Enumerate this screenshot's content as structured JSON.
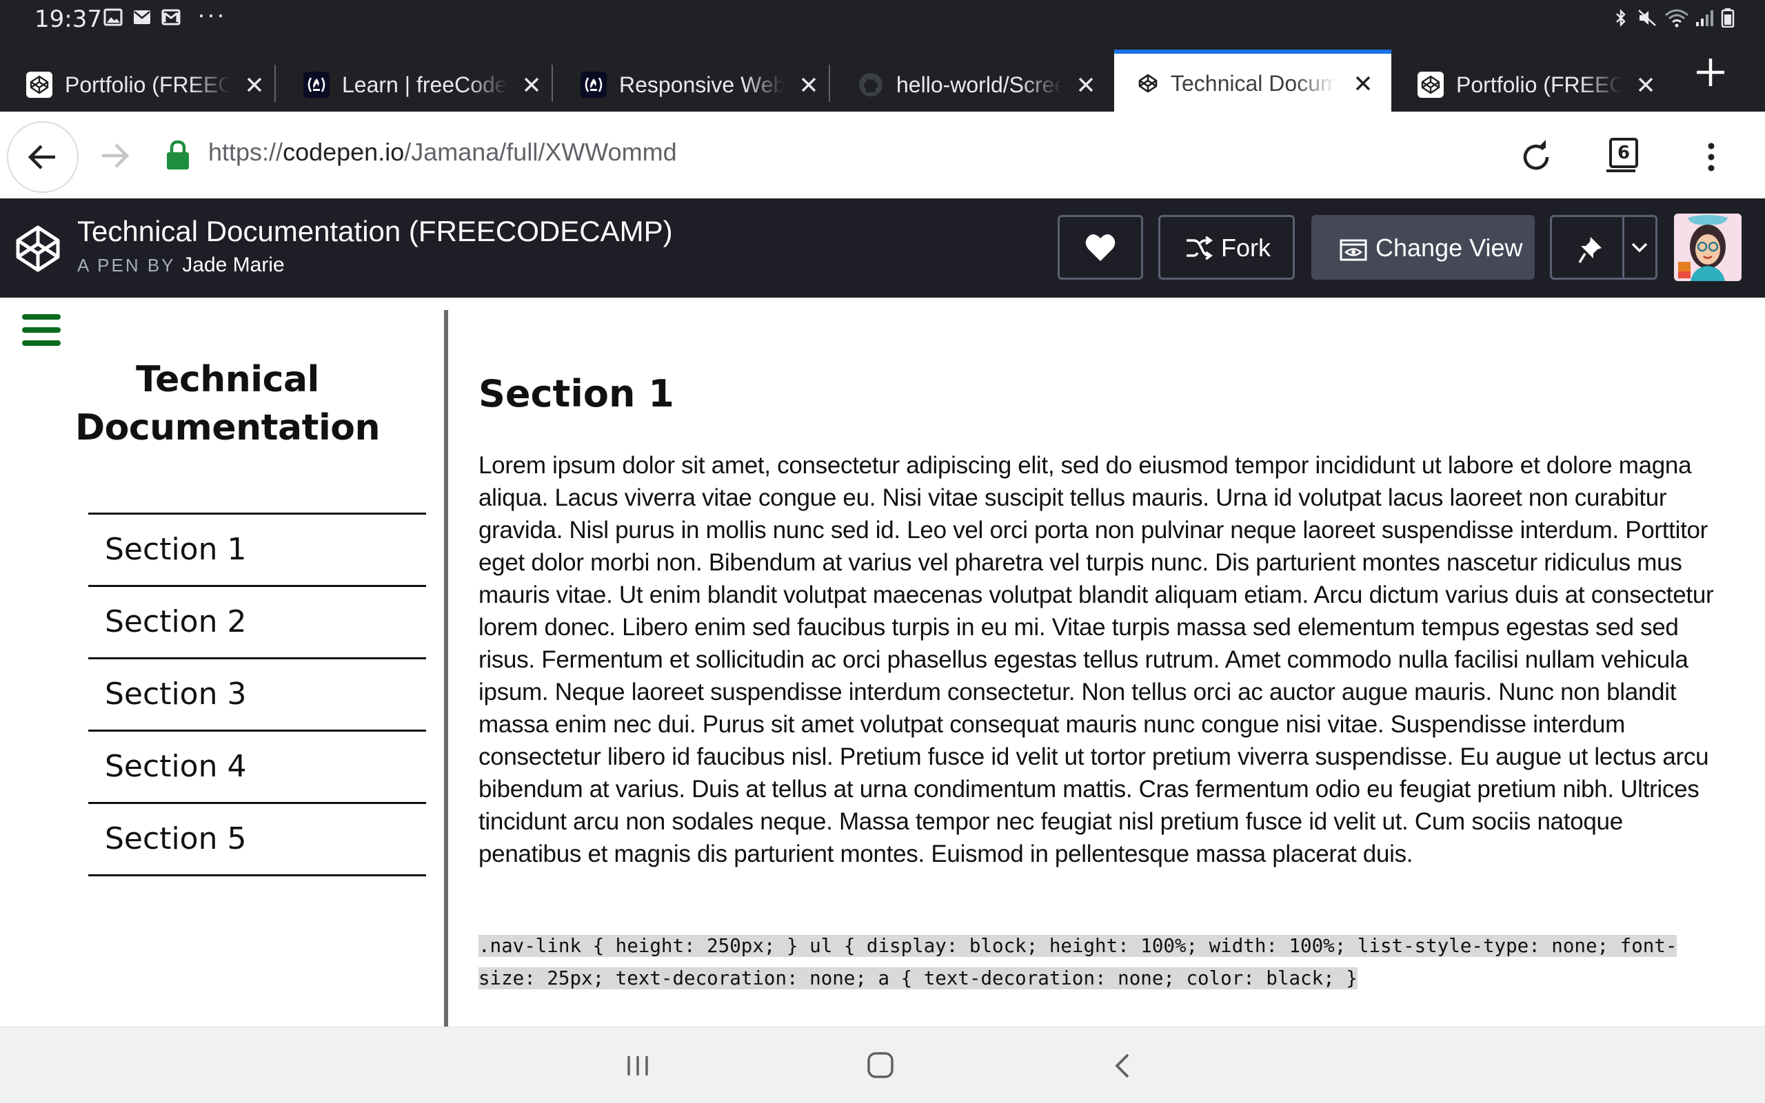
{
  "status_bar": {
    "time": "19:37",
    "more": "···"
  },
  "tabs": [
    {
      "title": "Portfolio (FREECODECAMP)",
      "icon": "codepen-icon",
      "active": false
    },
    {
      "title": "Learn | freeCodeCamp.org",
      "icon": "freecodecamp-icon",
      "active": false
    },
    {
      "title": "Responsive Web Design",
      "icon": "freecodecamp-icon",
      "active": false
    },
    {
      "title": "hello-world/Screenshot",
      "icon": "github-icon",
      "active": false
    },
    {
      "title": "Technical Documentation",
      "icon": "codepen-icon",
      "active": true
    },
    {
      "title": "Portfolio (FREECODECAMP)",
      "icon": "codepen-icon",
      "active": false
    }
  ],
  "address_bar": {
    "scheme": "https://",
    "host": "codepen.io",
    "path": "/Jamana/full/XWWommd",
    "tab_count": "6"
  },
  "codepen": {
    "title": "Technical Documentation (FREECODECAMP)",
    "by_label": "A PEN BY",
    "author": "Jade Marie",
    "fork_label": "Fork",
    "change_view_label": "Change View"
  },
  "page": {
    "nav_title": "Technical Documentation",
    "nav_items": [
      "Section 1",
      "Section 2",
      "Section 3",
      "Section 4",
      "Section 5"
    ],
    "section_heading": "Section 1",
    "paragraph": "Lorem ipsum dolor sit amet, consectetur adipiscing elit, sed do eiusmod tempor incididunt ut labore et dolore magna aliqua. Lacus viverra vitae congue eu. Nisi vitae suscipit tellus mauris. Urna id volutpat lacus laoreet non curabitur gravida. Nisl purus in mollis nunc sed id. Leo vel orci porta non pulvinar neque laoreet suspendisse interdum. Porttitor eget dolor morbi non. Bibendum at varius vel pharetra vel turpis nunc. Dis parturient montes nascetur ridiculus mus mauris vitae. Ut enim blandit volutpat maecenas volutpat blandit aliquam etiam. Arcu dictum varius duis at consectetur lorem donec. Libero enim sed faucibus turpis in eu mi. Vitae turpis massa sed elementum tempus egestas sed sed risus. Fermentum et sollicitudin ac orci phasellus egestas tellus rutrum. Amet commodo nulla facilisi nullam vehicula ipsum. Neque laoreet suspendisse interdum consectetur. Non tellus orci ac auctor augue mauris. Nunc non blandit massa enim nec dui. Purus sit amet volutpat consequat mauris nunc congue nisi vitae. Suspendisse interdum consectetur libero id faucibus nisl. Pretium fusce id velit ut tortor pretium viverra suspendisse. Eu augue ut lectus arcu bibendum at varius. Duis at tellus at urna condimentum mattis. Cras fermentum odio eu feugiat pretium nibh. Ultrices tincidunt arcu non sodales neque. Massa tempor nec feugiat nisl pretium fusce id velit ut. Cum sociis natoque penatibus et magnis dis parturient montes. Euismod in pellentesque massa placerat duis.",
    "code": ".nav-link { height: 250px; } ul { display: block; height: 100%; width: 100%; list-style-type: none; font-size: 25px; text-decoration: none; a { text-decoration: none; color: black; }"
  },
  "colors": {
    "active_tab_indicator": "#1a73e8",
    "lock_green": "#1e8e3e",
    "hamburger_green": "#0a6b1f",
    "codepen_header_bg": "#1e1f26",
    "code_bg": "#d9d9d9"
  }
}
